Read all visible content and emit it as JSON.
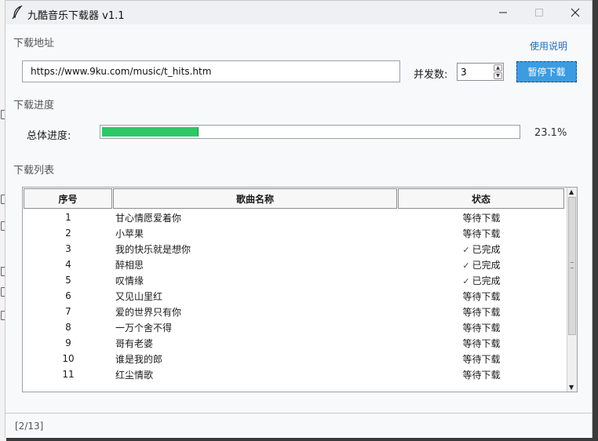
{
  "window": {
    "title": "九酷音乐下载器 v1.1",
    "icon": "feather-icon"
  },
  "address_section": {
    "label": "下载地址",
    "help_link": "使用说明",
    "url_value": "https://www.9ku.com/music/t_hits.htm",
    "concurrency_label": "并发数:",
    "concurrency_value": "3",
    "pause_button": "暂停下载"
  },
  "progress_section": {
    "label": "下载进度",
    "overall_label": "总体进度:",
    "percent_text": "23.1%",
    "percent_value": 23.1
  },
  "list_section": {
    "label": "下载列表",
    "columns": [
      "序号",
      "歌曲名称",
      "状态"
    ],
    "rows": [
      {
        "num": "1",
        "name": "甘心情愿爱着你",
        "status": "等待下载",
        "done": false
      },
      {
        "num": "2",
        "name": "小苹果",
        "status": "等待下载",
        "done": false
      },
      {
        "num": "3",
        "name": "我的快乐就是想你",
        "status": "已完成",
        "done": true
      },
      {
        "num": "4",
        "name": "醉相思",
        "status": "已完成",
        "done": true
      },
      {
        "num": "5",
        "name": "叹情缘",
        "status": "已完成",
        "done": true
      },
      {
        "num": "6",
        "name": "又见山里红",
        "status": "等待下载",
        "done": false
      },
      {
        "num": "7",
        "name": "爱的世界只有你",
        "status": "等待下载",
        "done": false
      },
      {
        "num": "8",
        "name": "一万个舍不得",
        "status": "等待下载",
        "done": false
      },
      {
        "num": "9",
        "name": "哥有老婆",
        "status": "等待下载",
        "done": false
      },
      {
        "num": "10",
        "name": "谁是我的郎",
        "status": "等待下载",
        "done": false
      },
      {
        "num": "11",
        "name": "红尘情歌",
        "status": "等待下载",
        "done": false
      }
    ],
    "done_mark": "✓"
  },
  "status_bar": {
    "text": "[2/13]"
  },
  "colors": {
    "accent_button": "#3d9be0",
    "progress_fill": "#2ec866",
    "link": "#1f6fb5"
  }
}
